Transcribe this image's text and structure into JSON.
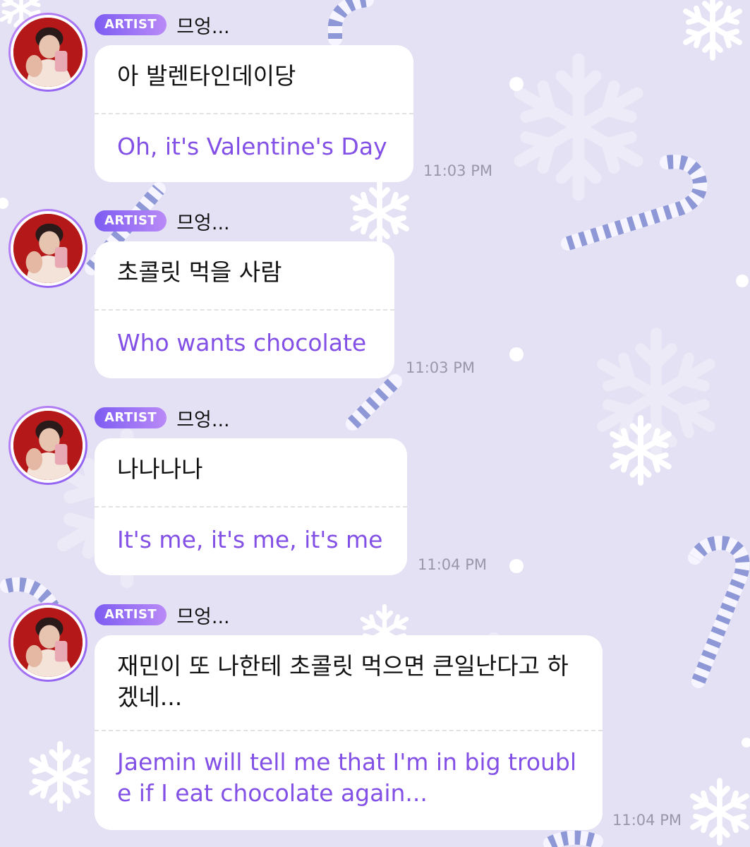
{
  "colors": {
    "background": "#e4e1f4",
    "badge_gradient_start": "#7d5cf2",
    "badge_gradient_end": "#b98af7",
    "translation_text": "#8350e6",
    "timestamp_text": "#9a97aa",
    "candy_cane_stripe": "#8e98d6",
    "avatar_ring": "#a973f4"
  },
  "messages": [
    {
      "badge": "ARTIST",
      "sender": "므엉...",
      "original": "아 발렌타인데이당",
      "translation": "Oh, it's Valentine's Day",
      "time": "11:03 PM"
    },
    {
      "badge": "ARTIST",
      "sender": "므엉...",
      "original": "초콜릿 먹을 사람",
      "translation": "Who wants chocolate",
      "time": "11:03 PM"
    },
    {
      "badge": "ARTIST",
      "sender": "므엉...",
      "original": "나나나나",
      "translation": "It's me, it's me, it's me",
      "time": "11:04 PM"
    },
    {
      "badge": "ARTIST",
      "sender": "므엉...",
      "original": "재민이 또 나한테 초콜릿 먹으면 큰일난다고 하겠네...",
      "translation": "Jaemin will tell me that I'm in big trouble if I eat chocolate again...",
      "time": "11:04 PM"
    }
  ],
  "icons": {
    "avatar": "artist-profile-photo",
    "background_decor": [
      "candy-cane-icon",
      "snowflake-icon",
      "snow-dot"
    ]
  }
}
